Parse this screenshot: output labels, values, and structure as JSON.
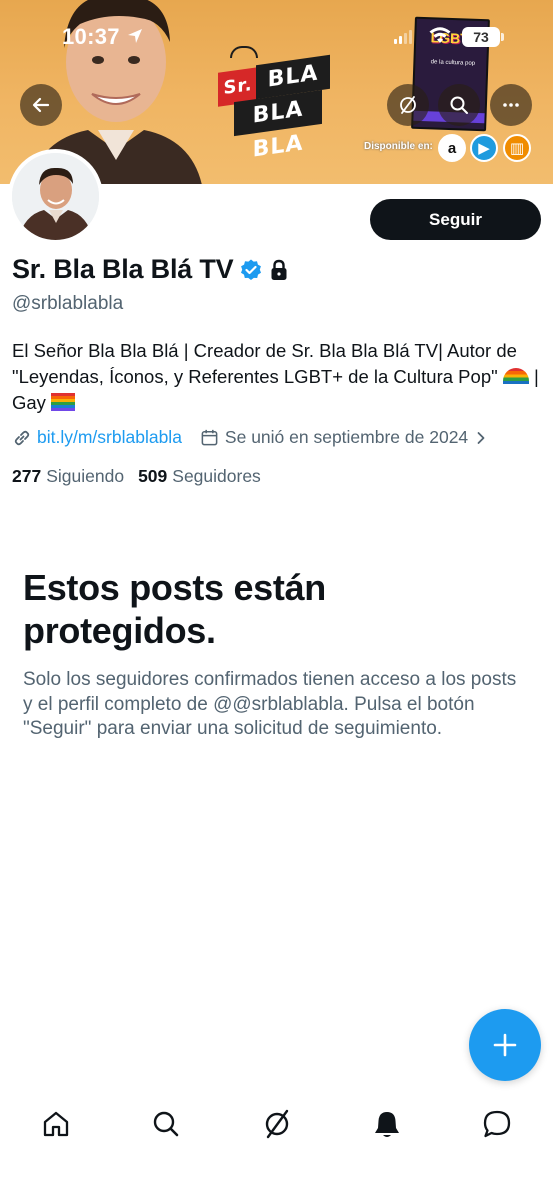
{
  "status_bar": {
    "time": "10:37",
    "battery": "73"
  },
  "banner": {
    "logo_sr": "Sr.",
    "logo_line1": "BLA",
    "logo_line2": "BLA BLA",
    "book_title": "LGBT+",
    "book_subtitle": "de la cultura pop",
    "available_label": "Disponible en:",
    "stores": [
      "amazon",
      "kobo",
      "books"
    ]
  },
  "header": {
    "back_icon": "arrow-left-icon",
    "grok_icon": "grok-icon",
    "search_icon": "search-icon",
    "more_icon": "more-horizontal-icon"
  },
  "profile": {
    "display_name": "Sr. Bla Bla Blá TV",
    "handle": "@srblablabla",
    "follow_label": "Seguir",
    "bio_part1": "El Señor Bla Bla Blá | Creador de Sr. Bla Bla Blá TV| Autor de \"Leyendas, Íconos, y Referentes LGBT+ de la Cultura Pop\" ",
    "bio_part2": " | Gay ",
    "link": "bit.ly/m/srblablabla",
    "joined": "Se unió en septiembre de 2024",
    "following_count": "277",
    "following_label": "Siguiendo",
    "followers_count": "509",
    "followers_label": "Seguidores"
  },
  "protected": {
    "title": "Estos posts están protegidos.",
    "description": "Solo los seguidores confirmados tienen acceso a los posts y el perfil completo de @@srblablabla. Pulsa el botón \"Seguir\" para enviar una solicitud de seguimiento."
  },
  "colors": {
    "accent": "#1d9bf0",
    "text_primary": "#0f1419",
    "text_secondary": "#536471",
    "banner": "#f0b563"
  },
  "nav": [
    "home-icon",
    "search-icon",
    "grok-icon",
    "notifications-icon",
    "messages-icon"
  ]
}
